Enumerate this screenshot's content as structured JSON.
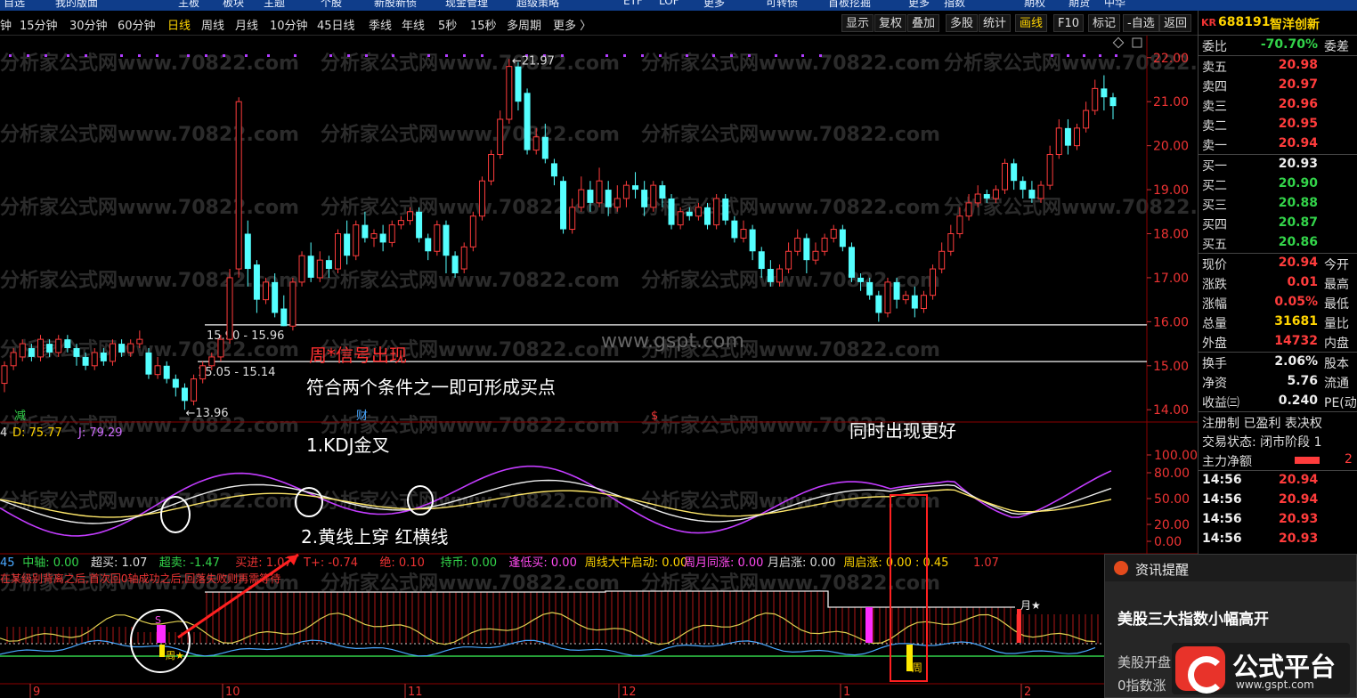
{
  "top_menu": [
    "自选",
    "我的版面",
    "主板",
    "板块",
    "主题",
    "个股",
    "新股新债",
    "现金管理",
    "超级策略",
    "ETF",
    "LOF",
    "更多",
    "可转债",
    "首板挖掘",
    "更多",
    "指数",
    "期权",
    "期货",
    "中华"
  ],
  "periods": [
    "钟",
    "15分钟",
    "30分钟",
    "60分钟",
    "日线",
    "周线",
    "月线",
    "10分钟",
    "45日线",
    "季线",
    "年线",
    "5秒",
    "15秒",
    "多周期",
    "更多 〉"
  ],
  "active_period": "日线",
  "toolbar": [
    "显示",
    "复权",
    "叠加",
    "多股",
    "统计",
    "画线",
    "F10",
    "标记",
    "-自选",
    "返回"
  ],
  "active_tool": "画线",
  "stock": {
    "market": "KR",
    "code": "688191",
    "name": "智洋创新"
  },
  "quote_top": {
    "label": "委比",
    "value": "-70.70%",
    "extra": "委差"
  },
  "sell": [
    {
      "label": "卖五",
      "price": "20.98"
    },
    {
      "label": "卖四",
      "price": "20.97"
    },
    {
      "label": "卖三",
      "price": "20.96"
    },
    {
      "label": "卖二",
      "price": "20.95"
    },
    {
      "label": "卖一",
      "price": "20.94"
    }
  ],
  "buy": [
    {
      "label": "买一",
      "price": "20.93"
    },
    {
      "label": "买二",
      "price": "20.90"
    },
    {
      "label": "买三",
      "price": "20.88"
    },
    {
      "label": "买四",
      "price": "20.87"
    },
    {
      "label": "买五",
      "price": "20.86"
    }
  ],
  "stats": [
    {
      "label": "现价",
      "value": "20.94",
      "extra": "今开",
      "color": "red"
    },
    {
      "label": "涨跌",
      "value": "0.01",
      "extra": "最高",
      "color": "red"
    },
    {
      "label": "涨幅",
      "value": "0.05%",
      "extra": "最低",
      "color": "red"
    },
    {
      "label": "总量",
      "value": "31681",
      "extra": "量比",
      "color": "yellow"
    },
    {
      "label": "外盘",
      "value": "14732",
      "extra": "内盘",
      "color": "red"
    }
  ],
  "stats2": [
    {
      "label": "换手",
      "value": "2.06%",
      "extra": "股本"
    },
    {
      "label": "净资",
      "value": "5.76",
      "extra": "流通"
    },
    {
      "label": "收益㈢",
      "value": "0.240",
      "extra": "PE(动"
    }
  ],
  "tags": "注册制 已盈利 表决权",
  "trade_status": "交易状态: 闭市阶段 1",
  "main_flow": {
    "label": "主力净额",
    "value": "2"
  },
  "ticks": [
    {
      "time": "14:56",
      "price": "20.94"
    },
    {
      "time": "14:56",
      "price": "20.94"
    },
    {
      "time": "14:56",
      "price": "20.93"
    },
    {
      "time": "14:56",
      "price": "20.93"
    }
  ],
  "notification": {
    "title": "资讯提醒",
    "headline": "美股三大指数小幅高开",
    "body1": "美股开盘",
    "body2": "0指数涨"
  },
  "logo": {
    "text": "公式平台",
    "url": "www.gspt.com"
  },
  "watermark": "分析家公式网www.70822.com",
  "watermark2": "www.gspt.com",
  "annotations": {
    "signal": "周*信号出现",
    "rule": "符合两个条件之一即可形成买点",
    "c1": "1.KDJ金叉",
    "c2": "2.黄线上穿 红横线",
    "both": "同时出现更好"
  },
  "support": {
    "upper": "15.90 - 15.96",
    "lower": "15.05 - 15.14"
  },
  "price_marks": {
    "high": "21.97",
    "low": "13.96"
  },
  "event_tags": {
    "cut": "减",
    "fin": "财",
    "s": "$"
  },
  "kdj_labels": {
    "k": "4",
    "d": "D: 75.77",
    "j": "J: 79.29"
  },
  "sub_axis": [
    "100.00",
    "80.00",
    "50.00",
    "20.00",
    "0.00"
  ],
  "ind_line1": [
    {
      "t": "45",
      "c": "#4aa8ff"
    },
    {
      "t": "中轴: 0.00",
      "c": "#33d44a"
    },
    {
      "t": "超买: 1.07",
      "c": "#ddd"
    },
    {
      "t": "超卖: -1.47",
      "c": "#33d44a"
    },
    {
      "t": "买进: 1.07",
      "c": "#e33"
    },
    {
      "t": "T+: -0.74",
      "c": "#e33"
    },
    {
      "t": "绝: 0.10",
      "c": "#e33"
    },
    {
      "t": "持币: 0.00",
      "c": "#33d44a"
    },
    {
      "t": "逢低买: 0.00",
      "c": "#ff4af0"
    },
    {
      "t": "周线大牛启动: 0.00",
      "c": "#ffd400"
    },
    {
      "t": "周月同涨: 0.00",
      "c": "#ff4af0"
    },
    {
      "t": "月启涨: 0.00",
      "c": "#ddd"
    },
    {
      "t": "周启涨: 0.00 : 0.45",
      "c": "#ffd400"
    },
    {
      "t": "1.07",
      "c": "#e33"
    }
  ],
  "ind_line2": "在某级别背离之后,首次回0轴成功之后,回落失败则再需等待",
  "date_labels": [
    "9",
    "10",
    "11",
    "12",
    "1",
    "2"
  ],
  "sub_marks": {
    "s": "S",
    "zhou1": "周★",
    "zhou2": "周",
    "yue": "月★"
  },
  "chart_data": {
    "type": "candlestick",
    "y_axis": {
      "ticks": [
        22.0,
        21.0,
        20.0,
        19.0,
        18.0,
        17.0,
        16.0,
        15.0,
        14.0
      ],
      "range": [
        13.6,
        22.4
      ]
    },
    "support_lines": [
      {
        "low": 15.9,
        "high": 15.96
      },
      {
        "low": 15.05,
        "high": 15.14
      }
    ],
    "candles": [
      [
        14.6,
        15.0,
        14.4,
        15.1
      ],
      [
        15.0,
        15.3,
        14.9,
        15.4
      ],
      [
        15.2,
        15.5,
        15.1,
        15.6
      ],
      [
        15.4,
        15.2,
        15.1,
        15.5
      ],
      [
        15.2,
        15.6,
        15.1,
        15.7
      ],
      [
        15.5,
        15.3,
        15.2,
        15.6
      ],
      [
        15.3,
        15.6,
        15.2,
        15.7
      ],
      [
        15.6,
        15.4,
        15.3,
        15.7
      ],
      [
        15.4,
        15.2,
        15.0,
        15.5
      ],
      [
        15.2,
        15.0,
        14.9,
        15.3
      ],
      [
        15.0,
        15.3,
        14.9,
        15.4
      ],
      [
        15.3,
        15.1,
        15.0,
        15.4
      ],
      [
        15.1,
        15.5,
        15.0,
        15.6
      ],
      [
        15.5,
        15.3,
        15.2,
        15.6
      ],
      [
        15.3,
        15.5,
        15.2,
        15.6
      ],
      [
        15.5,
        15.6,
        15.4,
        15.8
      ],
      [
        15.3,
        14.8,
        14.7,
        15.4
      ],
      [
        14.8,
        15.0,
        14.7,
        15.2
      ],
      [
        15.0,
        14.7,
        14.6,
        15.1
      ],
      [
        14.7,
        14.5,
        14.3,
        14.8
      ],
      [
        14.5,
        14.2,
        14.0,
        14.6
      ],
      [
        14.2,
        14.7,
        14.1,
        14.8
      ],
      [
        14.7,
        15.0,
        14.6,
        15.1
      ],
      [
        15.0,
        15.2,
        14.9,
        15.3
      ],
      [
        15.2,
        15.6,
        15.1,
        15.7
      ],
      [
        15.6,
        17.0,
        15.5,
        17.2
      ],
      [
        17.2,
        21.0,
        17.0,
        21.1
      ],
      [
        18.0,
        17.2,
        16.8,
        18.3
      ],
      [
        17.3,
        16.5,
        16.2,
        17.4
      ],
      [
        16.5,
        16.9,
        16.4,
        17.0
      ],
      [
        16.9,
        16.2,
        16.1,
        17.1
      ],
      [
        16.3,
        15.9,
        15.9,
        16.6
      ],
      [
        15.9,
        16.9,
        15.8,
        17.0
      ],
      [
        16.9,
        17.5,
        16.8,
        17.6
      ],
      [
        17.5,
        17.0,
        16.9,
        17.8
      ],
      [
        17.0,
        17.4,
        16.9,
        17.6
      ],
      [
        17.4,
        17.2,
        17.0,
        17.5
      ],
      [
        17.2,
        18.0,
        17.1,
        18.1
      ],
      [
        18.0,
        17.5,
        17.3,
        18.3
      ],
      [
        17.5,
        18.2,
        17.4,
        18.3
      ],
      [
        18.2,
        17.9,
        17.8,
        18.5
      ],
      [
        17.9,
        18.0,
        17.7,
        18.1
      ],
      [
        18.0,
        17.8,
        17.6,
        18.2
      ],
      [
        17.8,
        18.2,
        17.7,
        18.3
      ],
      [
        18.2,
        18.3,
        18.1,
        18.4
      ],
      [
        18.3,
        18.5,
        18.2,
        18.6
      ],
      [
        18.5,
        17.9,
        17.8,
        18.6
      ],
      [
        17.9,
        17.6,
        17.4,
        18.0
      ],
      [
        17.6,
        18.2,
        17.5,
        18.3
      ],
      [
        18.2,
        17.5,
        17.1,
        18.3
      ],
      [
        17.5,
        17.1,
        17.0,
        17.6
      ],
      [
        17.2,
        17.7,
        17.1,
        17.8
      ],
      [
        17.7,
        18.4,
        17.6,
        18.5
      ],
      [
        18.4,
        19.2,
        18.3,
        19.3
      ],
      [
        19.2,
        19.8,
        19.1,
        19.9
      ],
      [
        19.8,
        20.6,
        19.7,
        20.8
      ],
      [
        20.6,
        21.8,
        20.5,
        21.97
      ],
      [
        21.8,
        21.0,
        20.8,
        21.9
      ],
      [
        21.2,
        19.9,
        19.8,
        21.3
      ],
      [
        19.9,
        20.2,
        19.8,
        20.4
      ],
      [
        20.2,
        19.7,
        19.6,
        20.5
      ],
      [
        19.6,
        19.3,
        19.1,
        19.7
      ],
      [
        19.2,
        18.1,
        18.0,
        19.3
      ],
      [
        18.1,
        18.6,
        18.0,
        18.8
      ],
      [
        18.6,
        19.0,
        18.5,
        19.3
      ],
      [
        19.0,
        18.7,
        18.5,
        19.2
      ],
      [
        18.7,
        19.2,
        18.6,
        19.5
      ],
      [
        19.0,
        18.6,
        18.4,
        19.2
      ],
      [
        18.6,
        18.8,
        18.5,
        19.1
      ],
      [
        18.8,
        19.1,
        18.6,
        19.2
      ],
      [
        19.1,
        19.0,
        18.8,
        19.4
      ],
      [
        19.0,
        18.6,
        18.4,
        19.2
      ],
      [
        18.6,
        19.1,
        18.5,
        19.2
      ],
      [
        19.1,
        18.8,
        18.6,
        19.2
      ],
      [
        18.8,
        18.2,
        18.1,
        18.9
      ],
      [
        18.2,
        18.5,
        18.1,
        18.6
      ],
      [
        18.5,
        18.4,
        18.3,
        18.6
      ],
      [
        18.4,
        18.6,
        18.3,
        18.7
      ],
      [
        18.6,
        18.2,
        18.1,
        18.7
      ],
      [
        18.2,
        18.8,
        18.1,
        18.9
      ],
      [
        18.8,
        18.3,
        18.2,
        18.9
      ],
      [
        18.3,
        17.9,
        17.8,
        18.4
      ],
      [
        17.9,
        18.1,
        17.8,
        18.3
      ],
      [
        18.1,
        17.6,
        17.4,
        18.2
      ],
      [
        17.6,
        17.2,
        17.0,
        17.7
      ],
      [
        17.2,
        16.9,
        16.8,
        17.4
      ],
      [
        16.9,
        17.2,
        16.8,
        17.3
      ],
      [
        17.2,
        17.6,
        17.1,
        17.8
      ],
      [
        17.6,
        17.9,
        17.5,
        18.1
      ],
      [
        17.9,
        17.4,
        17.1,
        18.0
      ],
      [
        17.4,
        17.6,
        17.3,
        17.8
      ],
      [
        17.6,
        17.9,
        17.5,
        18.0
      ],
      [
        17.9,
        18.1,
        17.8,
        18.2
      ],
      [
        18.1,
        17.7,
        17.6,
        18.2
      ],
      [
        17.7,
        17.0,
        16.9,
        17.8
      ],
      [
        17.0,
        16.9,
        16.7,
        17.1
      ],
      [
        16.9,
        16.6,
        16.5,
        17.0
      ],
      [
        16.6,
        16.2,
        16.0,
        16.7
      ],
      [
        16.2,
        16.9,
        16.1,
        17.0
      ],
      [
        16.9,
        16.5,
        16.3,
        17.0
      ],
      [
        16.5,
        16.6,
        16.4,
        16.7
      ],
      [
        16.6,
        16.3,
        16.1,
        16.8
      ],
      [
        16.3,
        16.6,
        16.2,
        16.7
      ],
      [
        16.6,
        17.2,
        16.5,
        17.3
      ],
      [
        17.2,
        17.6,
        17.1,
        17.8
      ],
      [
        17.6,
        18.0,
        17.5,
        18.2
      ],
      [
        18.0,
        18.4,
        17.9,
        18.6
      ],
      [
        18.4,
        18.7,
        18.3,
        18.9
      ],
      [
        18.7,
        18.9,
        18.6,
        19.1
      ],
      [
        18.9,
        18.8,
        18.7,
        19.0
      ],
      [
        18.8,
        19.0,
        18.7,
        19.1
      ],
      [
        19.0,
        19.6,
        18.9,
        19.7
      ],
      [
        19.6,
        19.2,
        19.0,
        19.7
      ],
      [
        19.2,
        19.0,
        18.8,
        19.3
      ],
      [
        19.0,
        18.8,
        18.7,
        19.2
      ],
      [
        18.8,
        19.1,
        18.7,
        19.2
      ],
      [
        19.1,
        19.8,
        19.0,
        20.0
      ],
      [
        19.8,
        20.4,
        19.7,
        20.6
      ],
      [
        20.4,
        20.0,
        19.8,
        20.6
      ],
      [
        20.0,
        20.4,
        19.9,
        20.5
      ],
      [
        20.4,
        20.8,
        20.3,
        21.0
      ],
      [
        20.8,
        21.3,
        20.7,
        21.5
      ],
      [
        21.3,
        21.1,
        20.8,
        21.6
      ],
      [
        21.1,
        20.9,
        20.6,
        21.2
      ]
    ]
  }
}
